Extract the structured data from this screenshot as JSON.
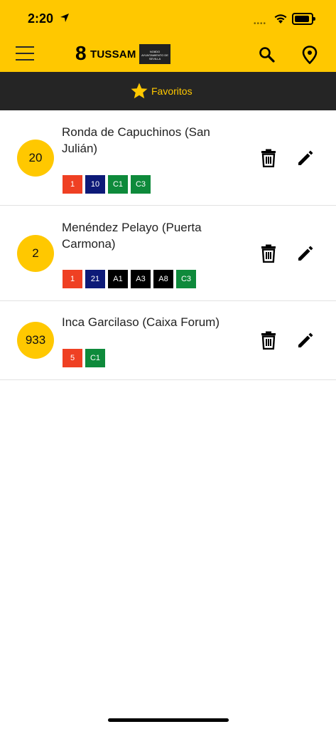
{
  "status_bar": {
    "time": "2:20"
  },
  "header": {
    "brand": "TUSSAM",
    "brand_mark": "8",
    "badge_text": "NO8DO AYUNTAMIENTO DE SEVILLA"
  },
  "tabs": {
    "favorites_label": "Favoritos"
  },
  "favorites": [
    {
      "stop_number": "20",
      "name": "Ronda de Capuchinos (San Julián)",
      "lines": [
        {
          "label": "1",
          "color": "#ef4023"
        },
        {
          "label": "10",
          "color": "#0d1a78"
        },
        {
          "label": "C1",
          "color": "#0e8a3b"
        },
        {
          "label": "C3",
          "color": "#0e8a3b"
        }
      ]
    },
    {
      "stop_number": "2",
      "name": "Menéndez Pelayo (Puerta Carmona)",
      "lines": [
        {
          "label": "1",
          "color": "#ef4023"
        },
        {
          "label": "21",
          "color": "#0d1a78"
        },
        {
          "label": "A1",
          "color": "#000000"
        },
        {
          "label": "A3",
          "color": "#000000"
        },
        {
          "label": "A8",
          "color": "#000000"
        },
        {
          "label": "C3",
          "color": "#0e8a3b"
        }
      ]
    },
    {
      "stop_number": "933",
      "name": "Inca Garcilaso (Caixa Forum)",
      "lines": [
        {
          "label": "5",
          "color": "#ef4023"
        },
        {
          "label": "C1",
          "color": "#0e8a3b"
        }
      ]
    }
  ],
  "colors": {
    "accent": "#ffc800",
    "tab_bar": "#252525"
  }
}
